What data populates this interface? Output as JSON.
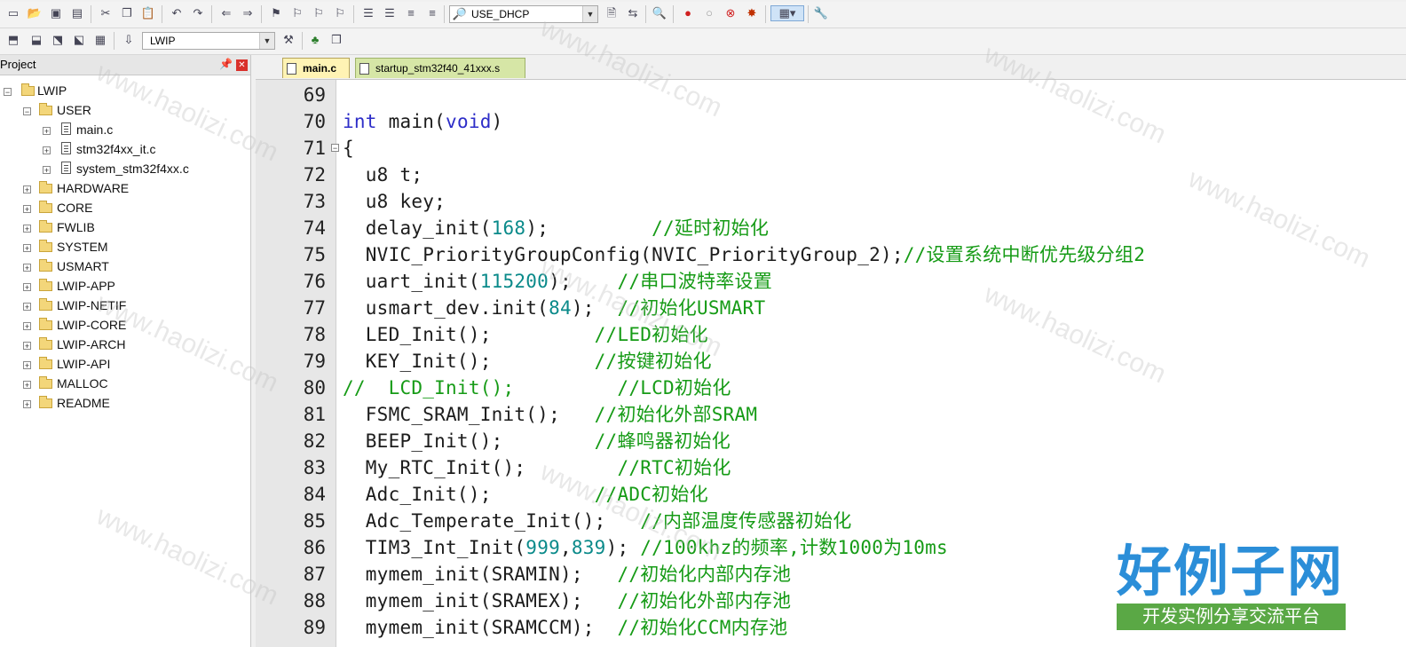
{
  "toolbar": {
    "target_combo_value": "USE_DHCP",
    "project_combo_value": "LWIP"
  },
  "project_panel": {
    "title": "Project"
  },
  "tree": {
    "root": "LWIP",
    "user_group": "USER",
    "user_files": [
      "main.c",
      "stm32f4xx_it.c",
      "system_stm32f4xx.c"
    ],
    "groups": [
      "HARDWARE",
      "CORE",
      "FWLIB",
      "SYSTEM",
      "USMART",
      "LWIP-APP",
      "LWIP-NETIF",
      "LWIP-CORE",
      "LWIP-ARCH",
      "LWIP-API",
      "MALLOC",
      "README"
    ]
  },
  "tabs": [
    {
      "label": "main.c"
    },
    {
      "label": "startup_stm32f40_41xxx.s"
    }
  ],
  "editor": {
    "line_numbers": [
      "69",
      "70",
      "71",
      "72",
      "73",
      "74",
      "75",
      "76",
      "77",
      "78",
      "79",
      "80",
      "81",
      "82",
      "83",
      "84",
      "85",
      "86",
      "87",
      "88",
      "89"
    ],
    "lines": [
      "",
      "int main(void)",
      "{",
      "  u8 t;",
      "  u8 key;",
      "  delay_init(168);         //延时初始化",
      "  NVIC_PriorityGroupConfig(NVIC_PriorityGroup_2);//设置系统中断优先级分组2",
      "  uart_init(115200);    //串口波特率设置",
      "  usmart_dev.init(84);  //初始化USMART",
      "  LED_Init();         //LED初始化",
      "  KEY_Init();         //按键初始化",
      "//  LCD_Init();         //LCD初始化",
      "  FSMC_SRAM_Init();   //初始化外部SRAM",
      "  BEEP_Init();        //蜂鸣器初始化",
      "  My_RTC_Init();        //RTC初始化",
      "  Adc_Init();         //ADC初始化",
      "  Adc_Temperate_Init();   //内部温度传感器初始化",
      "  TIM3_Int_Init(999,839); //100khz的频率,计数1000为10ms",
      "  mymem_init(SRAMIN);   //初始化内部内存池",
      "  mymem_init(SRAMEX);   //初始化外部内存池",
      "  mymem_init(SRAMCCM);  //初始化CCM内存池"
    ]
  },
  "watermark": "www.haolizi.com",
  "brand": {
    "name": "好例子网",
    "slogan": "开发实例分享交流平台"
  },
  "colors": {
    "keyword": "#2d2dc8",
    "number": "#0a8a8a",
    "comment": "#169b16",
    "brand_blue": "#2b8ed8",
    "brand_green": "#5aa845"
  }
}
